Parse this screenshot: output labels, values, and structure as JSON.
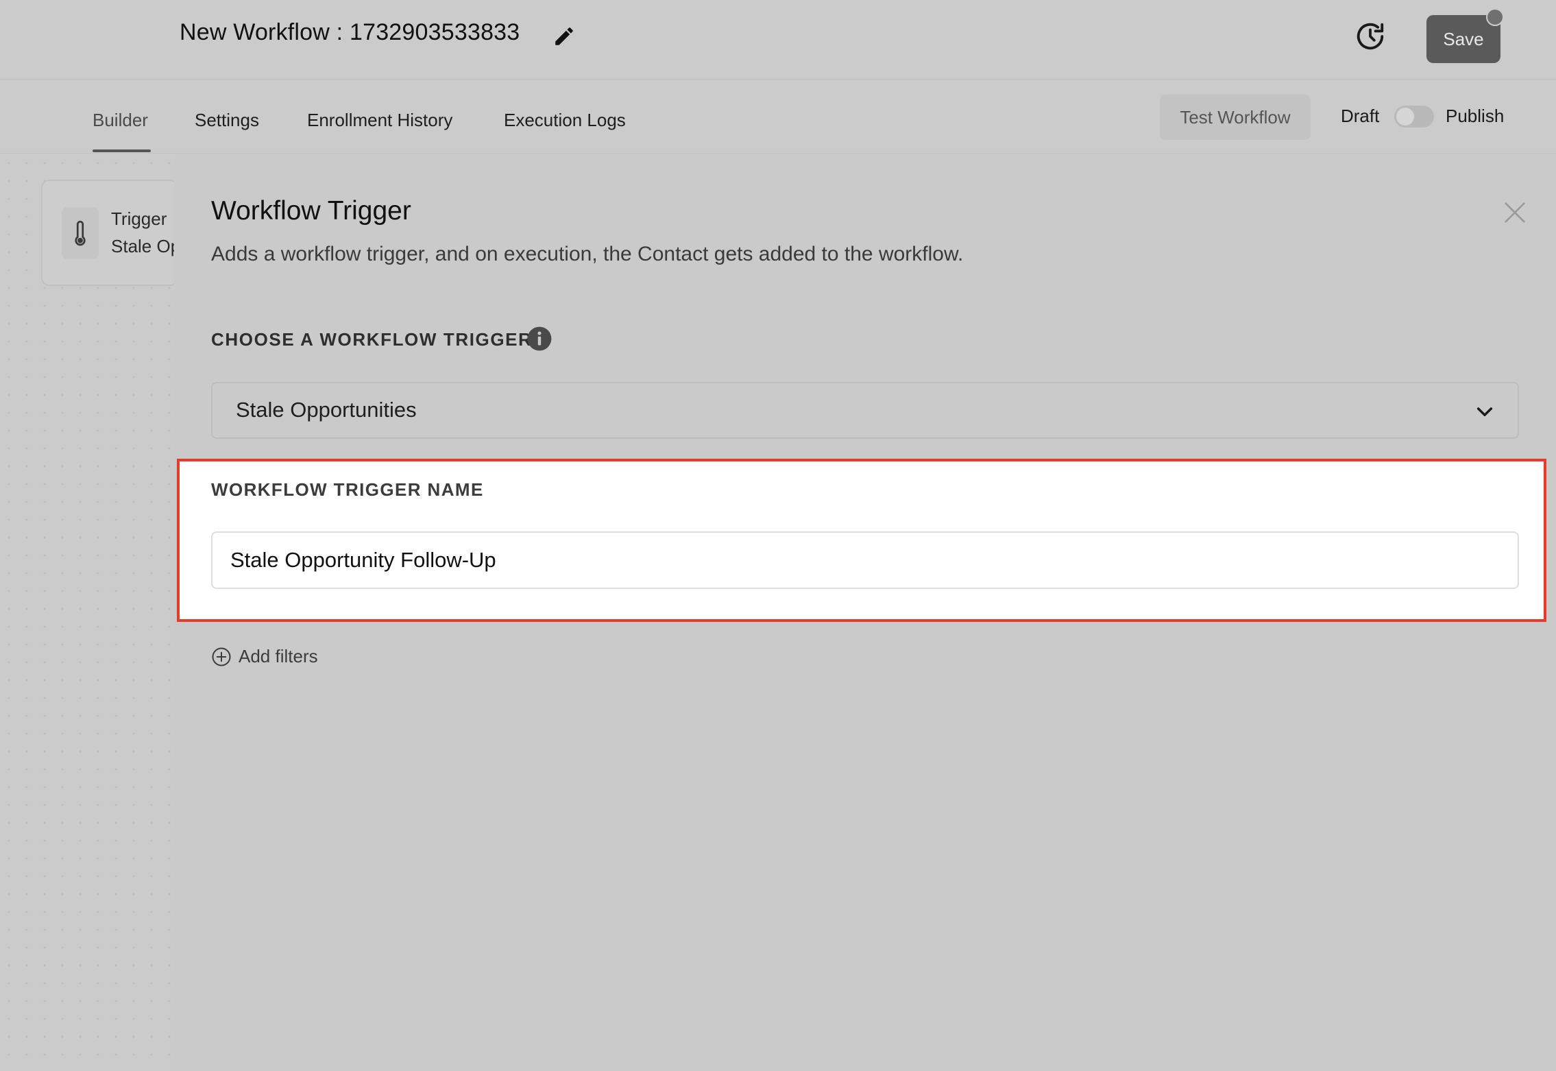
{
  "header": {
    "workflow_title": "New Workflow : 1732903533833",
    "save_label": "Save"
  },
  "tabs": [
    {
      "label": "Builder",
      "active": true
    },
    {
      "label": "Settings",
      "active": false
    },
    {
      "label": "Enrollment History",
      "active": false
    },
    {
      "label": "Execution Logs",
      "active": false
    }
  ],
  "actions": {
    "test_label": "Test Workflow",
    "draft_label": "Draft",
    "publish_label": "Publish",
    "published": false
  },
  "canvas": {
    "node": {
      "title": "Trigger",
      "subtitle": "Stale Opportunities"
    }
  },
  "panel": {
    "title": "Workflow Trigger",
    "description": "Adds a workflow trigger, and on execution, the Contact gets added to the workflow.",
    "trigger_label": "CHOOSE A WORKFLOW TRIGGER",
    "trigger_value": "Stale Opportunities",
    "name_label": "WORKFLOW TRIGGER NAME",
    "name_value": "Stale Opportunity Follow-Up",
    "add_filters_label": "Add filters"
  },
  "colors": {
    "highlight_border": "#e8392c",
    "save_button": "#5a5a5a"
  }
}
